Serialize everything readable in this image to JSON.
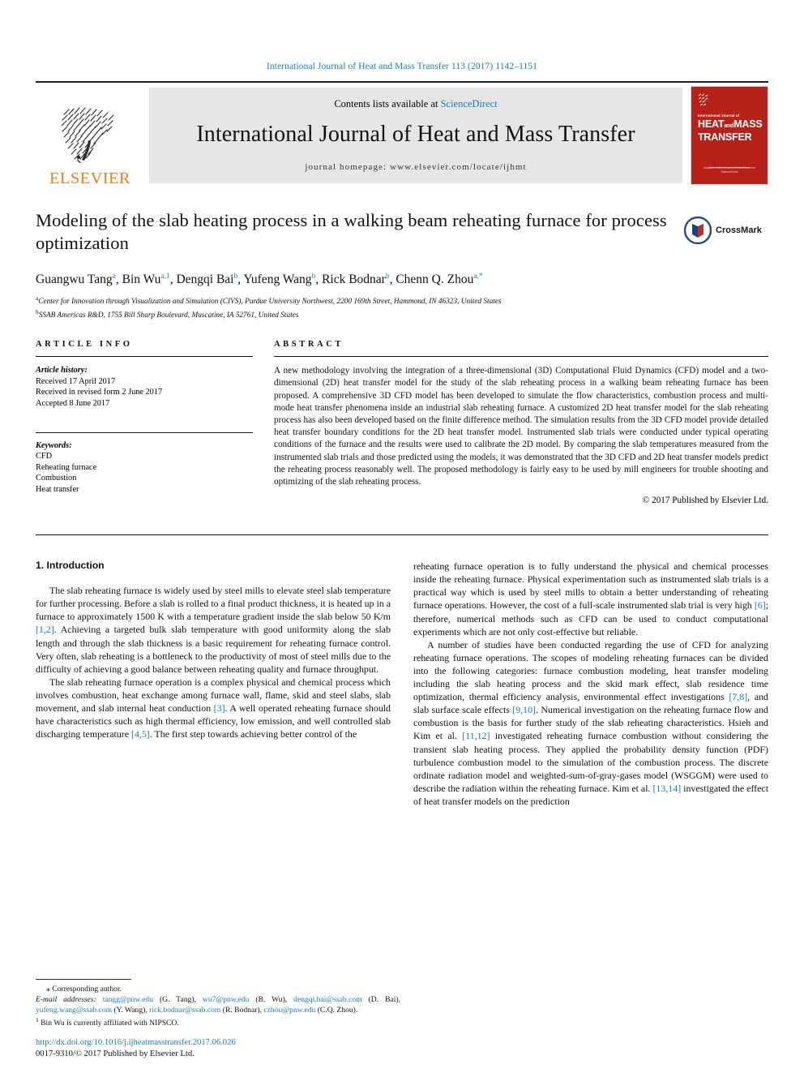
{
  "runninghead": "International Journal of Heat and Mass Transfer 113 (2017) 1142–1151",
  "masthead": {
    "publisher_logo_text": "ELSEVIER",
    "contents_prefix": "Contents lists available at ",
    "contents_link": "ScienceDirect",
    "journal_title": "International Journal of Heat and Mass Transfer",
    "homepage": "journal homepage: www.elsevier.com/locate/ijhmt",
    "cover": {
      "subtitle": "International Journal of",
      "title_line1": "HEAT",
      "title_and": "and",
      "title_line1b": "MASS",
      "title_line2": "TRANSFER",
      "footer": "Available online at www.sciencedirect.com",
      "footer2": "ScienceDirect"
    }
  },
  "article": {
    "title": "Modeling of the slab heating process in a walking beam reheating furnace for process optimization",
    "crossmark_label": "CrossMark",
    "authors": [
      {
        "name": "Guangwu Tang",
        "sup": "a"
      },
      {
        "name": "Bin Wu",
        "sup": "a,1"
      },
      {
        "name": "Dengqi Bai",
        "sup": "b"
      },
      {
        "name": "Yufeng Wang",
        "sup": "b"
      },
      {
        "name": "Rick Bodnar",
        "sup": "b"
      },
      {
        "name": "Chenn Q. Zhou",
        "sup": "a,*"
      }
    ],
    "affiliations": [
      {
        "mark": "a",
        "text": "Center for Innovation through Visualization and Simulation (CIVS), Purdue University Northwest, 2200 169th Street, Hammond, IN 46323, United States"
      },
      {
        "mark": "b",
        "text": "SSAB Americas R&D, 1755 Bill Sharp Boulevard, Muscatine, IA 52761, United States"
      }
    ]
  },
  "info": {
    "heading": "ARTICLE INFO",
    "history_label": "Article history:",
    "history": [
      "Received 17 April 2017",
      "Received in revised form 2 June 2017",
      "Accepted 8 June 2017"
    ],
    "keywords_label": "Keywords:",
    "keywords": [
      "CFD",
      "Reheating furnace",
      "Combustion",
      "Heat transfer"
    ]
  },
  "abstract": {
    "heading": "ABSTRACT",
    "body": "A new methodology involving the integration of a three-dimensional (3D) Computational Fluid Dynamics (CFD) model and a two-dimensional (2D) heat transfer model for the study of the slab reheating process in a walking beam reheating furnace has been proposed. A comprehensive 3D CFD model has been developed to simulate the flow characteristics, combustion process and multi-mode heat transfer phenomena inside an industrial slab reheating furnace. A customized 2D heat transfer model for the slab reheating process has also been developed based on the finite difference method. The simulation results from the 3D CFD model provide detailed heat transfer boundary conditions for the 2D heat transfer model. Instrumented slab trials were conducted under typical operating conditions of the furnace and the results were used to calibrate the 2D model. By comparing the slab temperatures measured from the instrumented slab trials and those predicted using the models, it was demonstrated that the 3D CFD and 2D heat transfer models predict the reheating process reasonably well. The proposed methodology is fairly easy to be used by mill engineers for trouble shooting and optimizing of the slab reheating process.",
    "copyright": "© 2017 Published by Elsevier Ltd."
  },
  "section": {
    "heading": "1. Introduction",
    "left_paragraphs": [
      {
        "segments": [
          {
            "t": "The slab reheating furnace is widely used by steel mills to elevate steel slab temperature for further processing. Before a slab is rolled to a final product thickness, it is heated up in a furnace to approximately 1500 K with a temperature gradient inside the slab below 50 K/m ",
            "ref": false
          },
          {
            "t": "[1,2]",
            "ref": true
          },
          {
            "t": ". Achieving a targeted bulk slab temperature with good uniformity along the slab length and through the slab thickness is a basic requirement for reheating furnace control. Very often, slab reheating is a bottleneck to the productivity of most of steel mills due to the difficulty of achieving a good balance between reheating quality and furnace throughput.",
            "ref": false
          }
        ]
      },
      {
        "segments": [
          {
            "t": "The slab reheating furnace operation is a complex physical and chemical process which involves combustion, heat exchange among furnace wall, flame, skid and steel slabs, slab movement, and slab internal heat conduction ",
            "ref": false
          },
          {
            "t": "[3]",
            "ref": true
          },
          {
            "t": ". A well operated reheating furnace should have characteristics such as high thermal efficiency, low emission, and well controlled slab discharging temperature ",
            "ref": false
          },
          {
            "t": "[4,5]",
            "ref": true
          },
          {
            "t": ". The first step towards achieving better control of the",
            "ref": false
          }
        ]
      }
    ],
    "right_paragraphs": [
      {
        "indent": false,
        "segments": [
          {
            "t": "reheating furnace operation is to fully understand the physical and chemical processes inside the reheating furnace. Physical experimentation such as instrumented slab trials is a practical way which is used by steel mills to obtain a better understanding of reheating furnace operations. However, the cost of a full-scale instrumented slab trial is very high ",
            "ref": false
          },
          {
            "t": "[6]",
            "ref": true
          },
          {
            "t": "; therefore, numerical methods such as CFD can be used to conduct computational experiments which are not only cost-effective but reliable.",
            "ref": false
          }
        ]
      },
      {
        "indent": true,
        "segments": [
          {
            "t": "A number of studies have been conducted regarding the use of CFD for analyzing reheating furnace operations. The scopes of modeling reheating furnaces can be divided into the following categories: furnace combustion modeling, heat transfer modeling including the slab heating process and the skid mark effect, slab residence time optimization, thermal efficiency analysis, environmental effect investigations ",
            "ref": false
          },
          {
            "t": "[7,8]",
            "ref": true
          },
          {
            "t": ", and slab surface scale effects ",
            "ref": false
          },
          {
            "t": "[9,10]",
            "ref": true
          },
          {
            "t": ". Numerical investigation on the reheating furnace flow and combustion is the basis for further study of the slab reheating characteristics. Hsieh and Kim et al. ",
            "ref": false
          },
          {
            "t": "[11,12]",
            "ref": true
          },
          {
            "t": " investigated reheating furnace combustion without considering the transient slab heating process. They applied the probability density function (PDF) turbulence combustion model to the simulation of the combustion process. The discrete ordinate radiation model and weighted-sum-of-gray-gases model (WSGGM) were used to describe the radiation within the reheating furnace. Kim et al. ",
            "ref": false
          },
          {
            "t": "[13,14]",
            "ref": true
          },
          {
            "t": " investigated the effect of heat transfer models on the prediction",
            "ref": false
          }
        ]
      }
    ]
  },
  "footnotes": {
    "corresponding_mark": "⁎",
    "corresponding_text": "Corresponding author.",
    "email_label": "E-mail addresses:",
    "emails": [
      {
        "addr": "tangg@pnw.edu",
        "who": "(G. Tang)"
      },
      {
        "addr": "wu7@pnw.edu",
        "who": "(B. Wu)"
      },
      {
        "addr": "dengqi.bai@ssab.com",
        "who": "(D. Bai)"
      },
      {
        "addr": "yufeng.wang@ssab.com",
        "who": "(Y. Wang)"
      },
      {
        "addr": "rick.bodnar@ssab.com",
        "who": "(R. Bodnar)"
      },
      {
        "addr": "czhou@pnw.edu",
        "who": "(C.Q. Zhou)"
      }
    ],
    "note1_mark": "1",
    "note1_text": "Bin Wu is currently affiliated with NIPSCO."
  },
  "doi": "http://dx.doi.org/10.1016/j.ijheatmasstransfer.2017.06.026",
  "issn_line": "0017-9310/© 2017 Published by Elsevier Ltd.",
  "colors": {
    "link": "#1a7bb9",
    "elsevier_orange": "#ef7d1a",
    "cover_red": "#b8211a"
  }
}
